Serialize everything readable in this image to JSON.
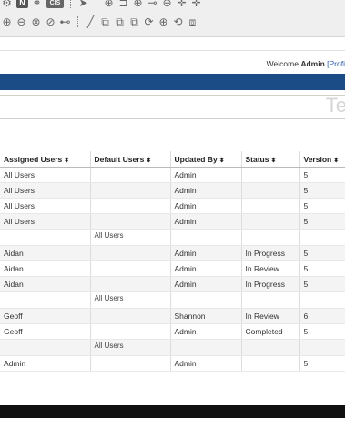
{
  "toolbar": {
    "row1": [
      {
        "icon": "gear-icon",
        "glyph": "⚙"
      },
      {
        "icon": "n-icon",
        "text": "N"
      },
      {
        "icon": "link-icon",
        "glyph": "⚭"
      },
      {
        "icon": "cis-icon",
        "text": "CIS"
      },
      {
        "icon": "cursor-icon",
        "glyph": "➤"
      },
      {
        "icon": "add-shape-icon",
        "glyph": "⊕"
      },
      {
        "icon": "bracket-icon",
        "glyph": "⊐"
      },
      {
        "icon": "add-node-icon",
        "glyph": "⊕"
      },
      {
        "icon": "connector-icon",
        "glyph": "⊸"
      },
      {
        "icon": "add-connector-icon",
        "glyph": "⊕"
      },
      {
        "icon": "plus-icon",
        "glyph": "✛"
      },
      {
        "icon": "plus-icon",
        "glyph": "✛"
      }
    ],
    "row2": [
      {
        "icon": "zoom-in-icon",
        "glyph": "⊕"
      },
      {
        "icon": "zoom-out-icon",
        "glyph": "⊖"
      },
      {
        "icon": "zoom-reset-icon",
        "glyph": "⊗"
      },
      {
        "icon": "zoom-fit-icon",
        "glyph": "⊘"
      },
      {
        "icon": "pan-icon",
        "glyph": "⊷"
      },
      {
        "icon": "line-icon",
        "glyph": "╱"
      },
      {
        "icon": "shape-link-icon",
        "glyph": "⧉"
      },
      {
        "icon": "shape-add-icon",
        "glyph": "⧉"
      },
      {
        "icon": "shape-remove-icon",
        "glyph": "⧉"
      },
      {
        "icon": "shape-refresh-icon",
        "glyph": "⟳"
      },
      {
        "icon": "shape-add2-icon",
        "glyph": "⊕"
      },
      {
        "icon": "shape-loop-icon",
        "glyph": "⟲"
      },
      {
        "icon": "export-icon",
        "glyph": "⧈"
      }
    ]
  },
  "header": {
    "welcome_prefix": "Welcome",
    "user_name": "Admin",
    "profile_link": "[Profi",
    "page_title_fragment": "Te"
  },
  "table": {
    "columns": [
      {
        "label": "Assigned Users"
      },
      {
        "label": "Default Users"
      },
      {
        "label": "Updated By"
      },
      {
        "label": "Status"
      },
      {
        "label": "Version"
      }
    ],
    "sort_glyph": "⬍",
    "rows": [
      {
        "assigned": "All Users",
        "default": "",
        "updated": "Admin",
        "status": "",
        "version": "5"
      },
      {
        "assigned": "All Users",
        "default": "",
        "updated": "Admin",
        "status": "",
        "version": "5"
      },
      {
        "assigned": "All Users",
        "default": "",
        "updated": "Admin",
        "status": "",
        "version": "5"
      },
      {
        "assigned": "All Users",
        "default": "",
        "updated": "Admin",
        "status": "",
        "version": "5"
      },
      {
        "assigned": "",
        "default": "All Users",
        "updated": "",
        "status": "",
        "version": "",
        "subgroup": true
      },
      {
        "assigned": "Aidan",
        "default": "",
        "updated": "Admin",
        "status": "In Progress",
        "version": "5"
      },
      {
        "assigned": "Aidan",
        "default": "",
        "updated": "Admin",
        "status": "In Review",
        "version": "5"
      },
      {
        "assigned": "Aidan",
        "default": "",
        "updated": "Admin",
        "status": "In Progress",
        "version": "5"
      },
      {
        "assigned": "",
        "default": "All Users",
        "updated": "",
        "status": "",
        "version": "",
        "subgroup": true
      },
      {
        "assigned": "Geoff",
        "default": "",
        "updated": "Shannon",
        "status": "In Review",
        "version": "6"
      },
      {
        "assigned": "Geoff",
        "default": "",
        "updated": "Admin",
        "status": "Completed",
        "version": "5"
      },
      {
        "assigned": "",
        "default": "All Users",
        "updated": "",
        "status": "",
        "version": "",
        "subgroup": true
      },
      {
        "assigned": "Admin",
        "default": "",
        "updated": "Admin",
        "status": "",
        "version": "5"
      }
    ]
  },
  "colors": {
    "nav_band": "#1c4c86",
    "link": "#2a5aa8",
    "footer": "#111111"
  }
}
